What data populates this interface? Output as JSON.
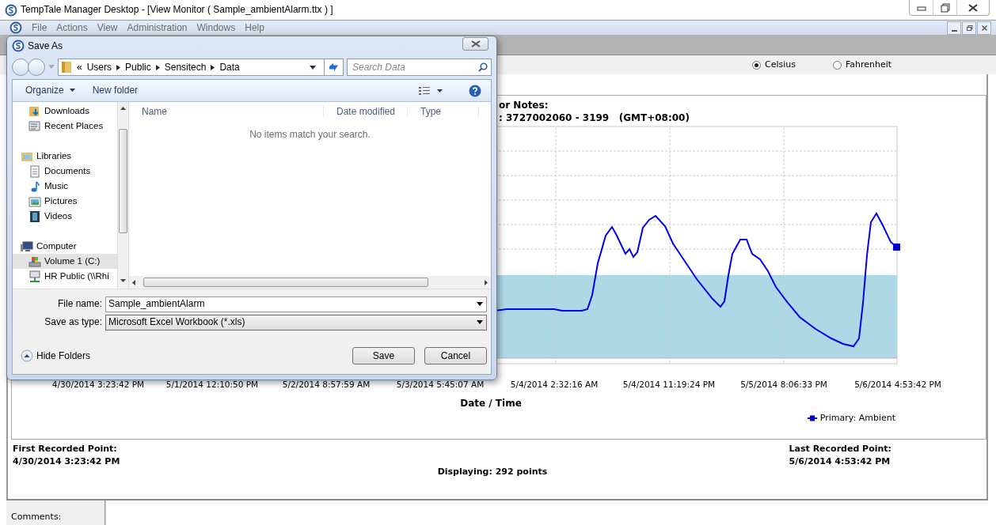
{
  "window": {
    "title": "TempTale Manager Desktop - [View Monitor ( Sample_ambientAlarm.ttx ) ]"
  },
  "menu": [
    "File",
    "Actions",
    "View",
    "Administration",
    "Windows",
    "Help"
  ],
  "units": [
    {
      "label": "Celsius",
      "selected": true
    },
    {
      "label": "Fahrenheit",
      "selected": false
    }
  ],
  "monitor": {
    "notes_label": "or Notes:",
    "serial": ": 3727002060 - 3199   (GMT+08:00)",
    "x_labels": [
      "4/30/2014 3:23:42 PM",
      "5/1/2014 12:10:50 PM",
      "5/2/2014 8:57:59 AM",
      "5/3/2014 5:45:07 AM",
      "5/4/2014 2:32:16 AM",
      "5/4/2014 11:19:24 PM",
      "5/5/2014 8:06:33 PM",
      "5/6/2014 4:53:42 PM"
    ],
    "x_title": "Date / Time",
    "legend": "Primary: Ambient",
    "first_label": "First Recorded Point:",
    "first_value": "4/30/2014 3:23:42 PM",
    "last_label": "Last Recorded Point:",
    "last_value": "5/6/2014 4:53:42 PM",
    "displaying": "Displaying: 292 points",
    "comments_label": "Comments:"
  },
  "dialog": {
    "title": "Save As",
    "breadcrumb": [
      "«",
      "Users",
      "Public",
      "Sensitech",
      "Data"
    ],
    "search_placeholder": "Search Data",
    "organize": "Organize",
    "new_folder": "New folder",
    "nav": [
      {
        "children": [
          {
            "label": "Downloads",
            "kind": "downloads",
            "selected": false
          },
          {
            "label": "Recent Places",
            "kind": "recent",
            "selected": false
          }
        ]
      },
      {
        "label": "Libraries",
        "kind": "libraries",
        "selected": false,
        "children": [
          {
            "label": "Documents",
            "kind": "documents",
            "selected": false
          },
          {
            "label": "Music",
            "kind": "music",
            "selected": false
          },
          {
            "label": "Pictures",
            "kind": "pictures",
            "selected": false
          },
          {
            "label": "Videos",
            "kind": "videos",
            "selected": false
          }
        ]
      },
      {
        "label": "Computer",
        "kind": "computer",
        "selected": false,
        "children": [
          {
            "label": "Volume 1 (C:)",
            "kind": "drive",
            "selected": true
          },
          {
            "label": "HR Public (\\\\Rhi",
            "kind": "network",
            "selected": false
          }
        ]
      }
    ],
    "columns": [
      "Name",
      "Date modified",
      "Type"
    ],
    "empty_message": "No items match your search.",
    "file_name_label": "File name:",
    "file_name": "Sample_ambientAlarm",
    "type_label": "Save as type:",
    "type_value": "Microsoft Excel Workbook (*.xls)",
    "hide_folders": "Hide Folders",
    "save": "Save",
    "cancel": "Cancel"
  }
}
